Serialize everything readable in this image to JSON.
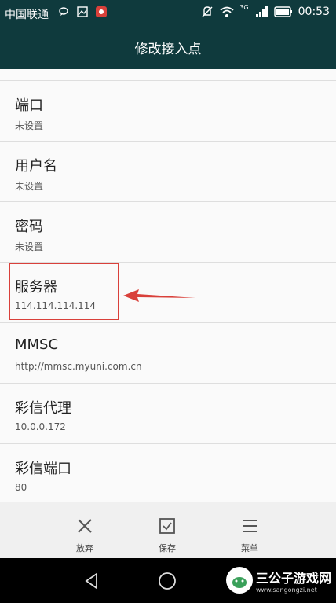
{
  "status_bar": {
    "carrier": "中国联通",
    "network": "3G",
    "time": "00:53"
  },
  "header": {
    "title": "修改接入点"
  },
  "settings": [
    {
      "label": "端口",
      "value": "未设置"
    },
    {
      "label": "用户名",
      "value": "未设置"
    },
    {
      "label": "密码",
      "value": "未设置"
    },
    {
      "label": "服务器",
      "value": "114.114.114.114"
    },
    {
      "label": "MMSC",
      "value": "http://mmsc.myuni.com.cn"
    },
    {
      "label": "彩信代理",
      "value": "10.0.0.172"
    },
    {
      "label": "彩信端口",
      "value": "80"
    }
  ],
  "actions": {
    "discard": "放弃",
    "save": "保存",
    "menu": "菜单"
  },
  "watermark": {
    "name": "三公子游戏网",
    "url": "www.sangongzi.net"
  },
  "colors": {
    "header_bg": "#0f3a3d",
    "highlight": "#d9403a"
  },
  "icons": [
    "wechat-icon",
    "gallery-icon",
    "huawei-icon",
    "mute-icon",
    "wifi-icon",
    "signal-icon",
    "battery-icon",
    "close-icon",
    "checkbox-icon",
    "menu-icon",
    "back-icon",
    "home-icon"
  ]
}
